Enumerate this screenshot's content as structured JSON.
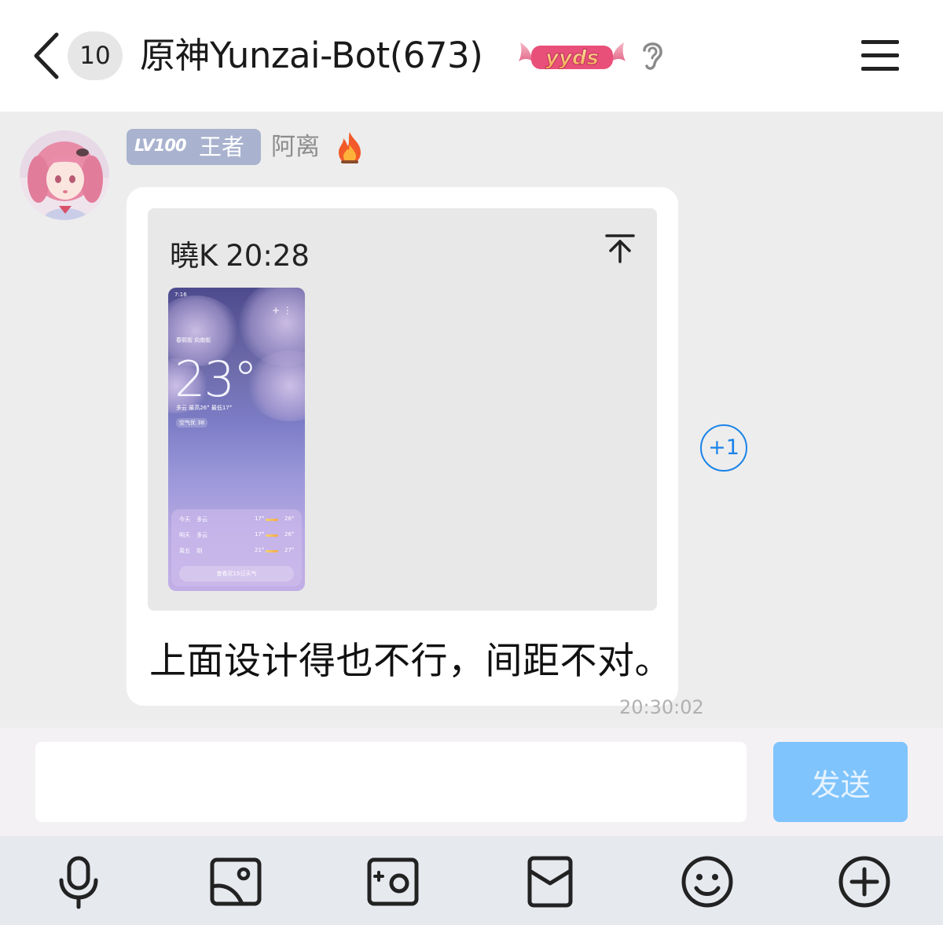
{
  "header": {
    "unread_count": "10",
    "title": "原神Yunzai-Bot(673)",
    "badge_text": "yyds"
  },
  "message": {
    "sender": {
      "level": "LV100",
      "rank": "王者",
      "name": "阿离"
    },
    "quote": {
      "author": "曉K",
      "time": "20:28",
      "thumbnail": {
        "status_time": "7:16",
        "location": "春熙街 向南街",
        "temperature": "23°",
        "condition": "多云  最高26° 最低17°",
        "air": "空气优 38",
        "forecast": [
          {
            "day": "今天",
            "cond": "多云",
            "low": "17°",
            "high": "26°"
          },
          {
            "day": "明天",
            "cond": "多云",
            "low": "17°",
            "high": "26°"
          },
          {
            "day": "周五",
            "cond": "阴",
            "low": "21°",
            "high": "27°"
          }
        ],
        "more_label": "查看近15日天气"
      }
    },
    "text": "上面设计得也不行，间距不对。",
    "timestamp": "20:30:02",
    "plus_one": "+1"
  },
  "composer": {
    "input_value": "",
    "send_label": "发送"
  },
  "toolbar": {
    "icons": [
      "microphone-icon",
      "image-icon",
      "camera-icon",
      "red-packet-icon",
      "emoji-icon",
      "plus-icon"
    ]
  },
  "colors": {
    "accent": "#1a83e8",
    "send_disabled": "#7fc4fd",
    "level_badge": "#a9b3cf"
  }
}
